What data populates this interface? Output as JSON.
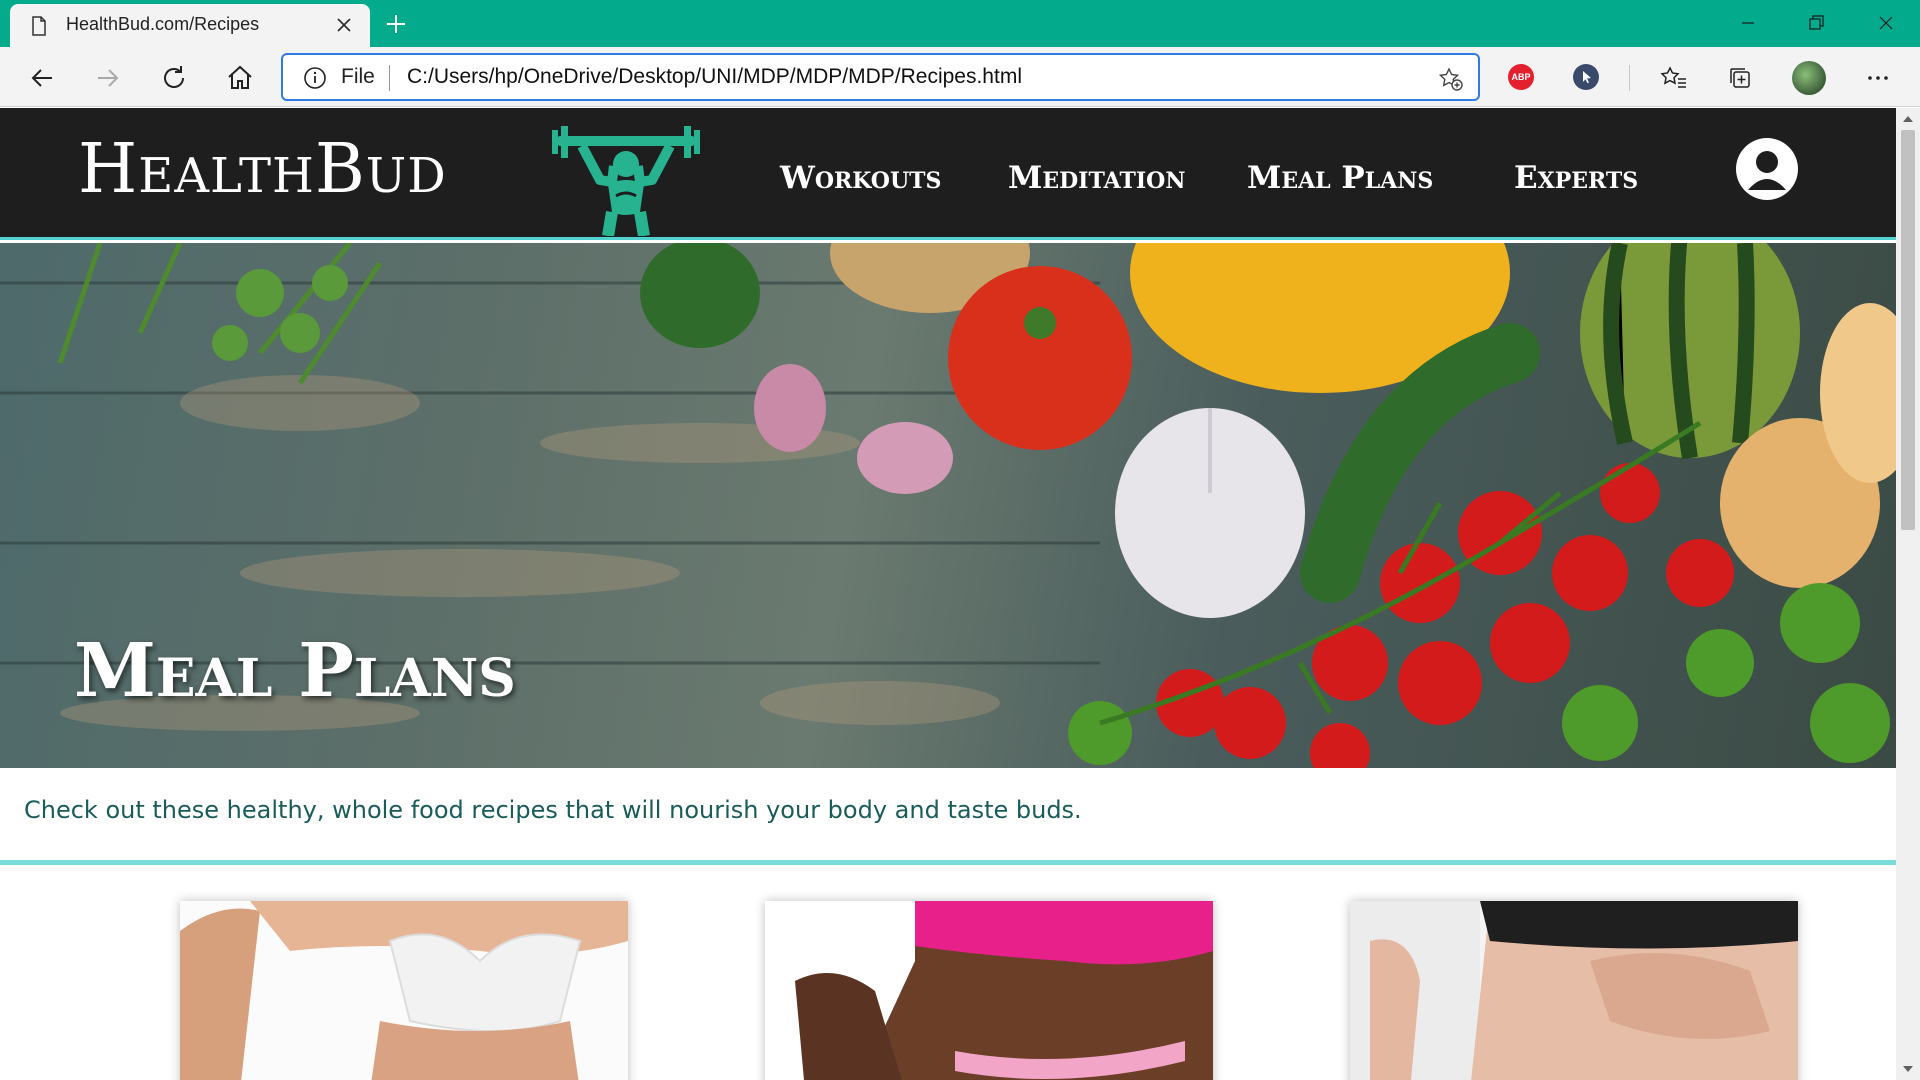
{
  "browser": {
    "tab_title": "HealthBud.com/Recipes",
    "address_scheme": "File",
    "address_url": "C:/Users/hp/OneDrive/Desktop/UNI/MDP/MDP/MDP/Recipes.html",
    "extension_abp_label": "ABP",
    "accent_color": "#03ab8c"
  },
  "site": {
    "logo_text": "HealthBud",
    "nav": [
      "Workouts",
      "Meditation",
      "Meal Plans",
      "Experts"
    ],
    "hero_title": "Meal Plans",
    "intro_text": "Check out these healthy, whole food recipes that will nourish your body and taste buds.",
    "colors": {
      "header_bg": "#1e1e1e",
      "accent": "#4fd2d0",
      "intro_text": "#1a5c5a"
    }
  },
  "cards": [
    {
      "icon": "woman-white-top-photo"
    },
    {
      "icon": "woman-measuring-tape-photo"
    },
    {
      "icon": "woman-hands-on-belly-photo"
    }
  ]
}
